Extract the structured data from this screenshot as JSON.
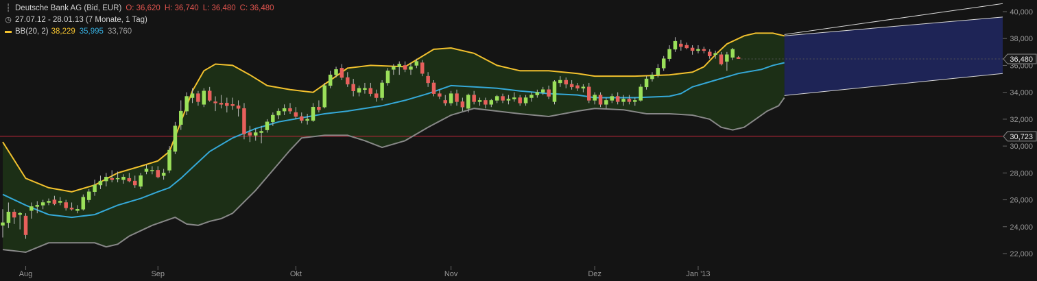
{
  "legend": {
    "instrument": "Deutsche Bank AG (Bid, EUR)",
    "open": "O: 36,620",
    "high": "H: 36,740",
    "low": "L: 36,480",
    "close": "C: 36,480",
    "period": "27.07.12 - 28.01.13 (7 Monate, 1 Tag)",
    "bb_label": "BB(20, 2)",
    "bb_upper": "38,229",
    "bb_middle": "35,995",
    "bb_lower": "33,760"
  },
  "colors": {
    "background": "#141414",
    "candle_up": "#9be05a",
    "candle_down": "#e8605c",
    "bb_upper": "#f2c12e",
    "bb_middle": "#35a9d8",
    "bb_lower": "#888888",
    "band_fill": "#1c2f16",
    "forecast_fill": "#1e2456",
    "reference_line": "#c0283a"
  },
  "chart_data": {
    "type": "candlestick",
    "title": "Deutsche Bank AG (Bid, EUR)",
    "ylim": [
      21.5,
      41.0
    ],
    "grid": false,
    "y_ticks": [
      22,
      24,
      26,
      28,
      30,
      32,
      34,
      36,
      38,
      40
    ],
    "y_tick_labels": [
      "22,000",
      "24,000",
      "26,000",
      "28,000",
      "30,000",
      "32,000",
      "34,000",
      "36,000",
      "38,000",
      "40,000"
    ],
    "x_ticks": [
      {
        "label": "Aug",
        "index": 4
      },
      {
        "label": "Sep",
        "index": 27
      },
      {
        "label": "Okt",
        "index": 51
      },
      {
        "label": "Nov",
        "index": 78
      },
      {
        "label": "Dez",
        "index": 103
      },
      {
        "label": "Jan '13",
        "index": 121
      }
    ],
    "last_price": {
      "label": "36,480",
      "value": 36.48
    },
    "reference_price": {
      "label": "30,723",
      "value": 30.723
    },
    "candles": [
      [
        24.1,
        25.3,
        23.2,
        24.3
      ],
      [
        24.3,
        25.8,
        23.9,
        25.1
      ],
      [
        25.1,
        25.3,
        24.2,
        24.7
      ],
      [
        24.9,
        25.1,
        23.8,
        25.0
      ],
      [
        24.8,
        25.0,
        23.1,
        23.4
      ],
      [
        25.2,
        25.8,
        24.6,
        25.5
      ],
      [
        25.5,
        25.9,
        25.0,
        25.6
      ],
      [
        25.6,
        26.0,
        25.3,
        25.8
      ],
      [
        25.8,
        26.1,
        25.6,
        25.9
      ],
      [
        26.0,
        26.3,
        25.6,
        25.7
      ],
      [
        25.8,
        26.2,
        25.6,
        25.9
      ],
      [
        25.8,
        26.0,
        25.2,
        25.4
      ],
      [
        25.4,
        25.8,
        25.2,
        25.3
      ],
      [
        25.2,
        25.6,
        25.0,
        25.3
      ],
      [
        25.3,
        26.4,
        25.2,
        26.2
      ],
      [
        26.0,
        26.8,
        25.8,
        26.6
      ],
      [
        26.6,
        27.5,
        26.3,
        27.1
      ],
      [
        27.1,
        27.8,
        26.8,
        27.4
      ],
      [
        27.4,
        28.0,
        27.0,
        27.7
      ],
      [
        27.6,
        28.2,
        27.3,
        27.5
      ],
      [
        27.6,
        28.1,
        27.3,
        27.6
      ],
      [
        27.5,
        27.9,
        27.2,
        27.7
      ],
      [
        27.6,
        28.0,
        27.3,
        27.4
      ],
      [
        27.4,
        27.8,
        26.9,
        27.1
      ],
      [
        27.0,
        28.0,
        26.8,
        27.8
      ],
      [
        28.1,
        28.6,
        27.9,
        28.3
      ],
      [
        28.2,
        28.5,
        27.9,
        28.2
      ],
      [
        28.2,
        28.5,
        27.6,
        27.7
      ],
      [
        27.8,
        28.3,
        27.5,
        28.0
      ],
      [
        28.2,
        30.0,
        28.0,
        29.7
      ],
      [
        29.6,
        31.8,
        29.4,
        31.5
      ],
      [
        31.6,
        33.4,
        31.2,
        32.6
      ],
      [
        32.6,
        34.0,
        32.3,
        33.7
      ],
      [
        33.6,
        34.3,
        33.2,
        33.9
      ],
      [
        33.9,
        34.1,
        33.0,
        33.3
      ],
      [
        33.1,
        34.3,
        32.9,
        34.1
      ],
      [
        34.1,
        34.4,
        33.3,
        33.4
      ],
      [
        33.3,
        33.7,
        32.6,
        33.2
      ],
      [
        33.2,
        33.8,
        32.8,
        33.1
      ],
      [
        33.2,
        33.6,
        32.5,
        33.0
      ],
      [
        33.1,
        33.6,
        32.7,
        33.0
      ],
      [
        33.0,
        33.4,
        32.2,
        32.8
      ],
      [
        32.8,
        33.2,
        30.5,
        30.9
      ],
      [
        31.0,
        31.5,
        30.3,
        30.8
      ],
      [
        30.8,
        31.3,
        30.4,
        31.0
      ],
      [
        31.0,
        31.5,
        30.2,
        31.1
      ],
      [
        31.2,
        32.0,
        31.0,
        31.8
      ],
      [
        31.8,
        32.5,
        31.5,
        32.3
      ],
      [
        32.3,
        32.8,
        32.0,
        32.6
      ],
      [
        32.6,
        33.1,
        32.3,
        32.8
      ],
      [
        32.8,
        33.2,
        32.4,
        32.6
      ],
      [
        32.5,
        32.9,
        32.0,
        32.2
      ],
      [
        32.2,
        32.5,
        31.7,
        31.9
      ],
      [
        31.9,
        32.4,
        31.6,
        32.0
      ],
      [
        31.9,
        33.2,
        31.8,
        32.9
      ],
      [
        32.9,
        33.4,
        32.5,
        32.7
      ],
      [
        32.9,
        34.7,
        32.8,
        34.5
      ],
      [
        34.5,
        35.6,
        34.3,
        35.3
      ],
      [
        35.3,
        35.9,
        35.1,
        35.7
      ],
      [
        35.8,
        36.1,
        34.9,
        35.1
      ],
      [
        35.1,
        35.5,
        34.4,
        34.6
      ],
      [
        34.6,
        35.0,
        33.7,
        34.1
      ],
      [
        34.0,
        34.5,
        33.7,
        34.3
      ],
      [
        34.2,
        34.7,
        33.9,
        34.3
      ],
      [
        34.3,
        34.7,
        33.7,
        33.9
      ],
      [
        33.9,
        34.2,
        33.3,
        33.6
      ],
      [
        33.6,
        34.9,
        33.4,
        34.7
      ],
      [
        34.7,
        35.8,
        34.5,
        35.6
      ],
      [
        35.7,
        36.1,
        35.3,
        35.9
      ],
      [
        35.9,
        36.3,
        35.3,
        36.1
      ],
      [
        36.0,
        36.3,
        35.5,
        35.7
      ],
      [
        35.7,
        36.2,
        35.3,
        35.9
      ],
      [
        36.0,
        36.5,
        35.8,
        36.3
      ],
      [
        36.2,
        36.4,
        35.2,
        35.4
      ],
      [
        35.2,
        35.5,
        34.4,
        34.7
      ],
      [
        34.7,
        34.9,
        33.7,
        33.9
      ],
      [
        33.9,
        34.2,
        33.5,
        33.7
      ],
      [
        33.4,
        33.8,
        33.0,
        33.2
      ],
      [
        33.2,
        34.1,
        33.0,
        33.9
      ],
      [
        33.9,
        34.2,
        33.0,
        33.3
      ],
      [
        33.3,
        33.6,
        32.6,
        32.9
      ],
      [
        32.8,
        33.9,
        32.5,
        33.8
      ],
      [
        33.8,
        34.1,
        33.1,
        33.3
      ],
      [
        33.3,
        33.6,
        33.0,
        33.4
      ],
      [
        33.4,
        33.6,
        32.8,
        33.1
      ],
      [
        33.1,
        33.5,
        32.9,
        33.4
      ],
      [
        33.4,
        33.8,
        33.2,
        33.7
      ],
      [
        33.7,
        33.9,
        33.2,
        33.4
      ],
      [
        33.4,
        33.8,
        33.1,
        33.5
      ],
      [
        33.5,
        34.0,
        33.3,
        33.6
      ],
      [
        33.6,
        33.8,
        33.0,
        33.2
      ],
      [
        33.2,
        33.8,
        33.0,
        33.6
      ],
      [
        33.6,
        34.0,
        33.3,
        33.8
      ],
      [
        33.8,
        34.2,
        33.6,
        34.0
      ],
      [
        34.0,
        34.4,
        33.8,
        34.2
      ],
      [
        34.2,
        34.5,
        33.5,
        33.7
      ],
      [
        33.3,
        34.9,
        33.1,
        34.8
      ],
      [
        34.7,
        35.2,
        34.4,
        34.9
      ],
      [
        34.9,
        35.1,
        34.3,
        34.6
      ],
      [
        34.6,
        34.9,
        34.2,
        34.4
      ],
      [
        34.5,
        34.7,
        34.1,
        34.3
      ],
      [
        34.3,
        34.6,
        34.0,
        34.4
      ],
      [
        34.4,
        34.7,
        33.2,
        33.4
      ],
      [
        33.4,
        34.0,
        33.1,
        33.8
      ],
      [
        33.8,
        34.0,
        32.9,
        33.1
      ],
      [
        33.1,
        33.6,
        32.8,
        33.4
      ],
      [
        33.4,
        33.9,
        33.2,
        33.7
      ],
      [
        33.7,
        34.0,
        33.1,
        33.3
      ],
      [
        33.3,
        33.8,
        33.0,
        33.5
      ],
      [
        33.5,
        33.8,
        33.1,
        33.3
      ],
      [
        33.3,
        33.6,
        33.0,
        33.4
      ],
      [
        33.4,
        34.6,
        33.3,
        34.4
      ],
      [
        34.4,
        35.2,
        34.2,
        35.0
      ],
      [
        35.0,
        35.5,
        34.8,
        35.3
      ],
      [
        35.3,
        36.1,
        35.1,
        35.8
      ],
      [
        35.8,
        36.7,
        35.6,
        36.5
      ],
      [
        36.5,
        37.5,
        36.3,
        37.2
      ],
      [
        37.2,
        38.1,
        37.0,
        37.8
      ],
      [
        37.6,
        37.9,
        37.1,
        37.4
      ],
      [
        37.5,
        37.7,
        37.2,
        37.3
      ],
      [
        37.3,
        37.5,
        36.8,
        37.1
      ],
      [
        37.1,
        37.5,
        36.9,
        37.2
      ],
      [
        37.2,
        37.4,
        36.9,
        37.1
      ],
      [
        37.0,
        37.2,
        36.5,
        36.7
      ],
      [
        36.8,
        37.1,
        36.5,
        36.9
      ],
      [
        36.8,
        37.0,
        36.0,
        36.1
      ],
      [
        36.3,
        37.0,
        35.6,
        36.8
      ],
      [
        36.6,
        37.3,
        36.4,
        37.2
      ],
      [
        36.6,
        36.7,
        36.5,
        36.5
      ]
    ],
    "bb_upper": [
      [
        0,
        30.3
      ],
      [
        4,
        27.6
      ],
      [
        8,
        26.9
      ],
      [
        12,
        26.6
      ],
      [
        16,
        27.1
      ],
      [
        20,
        28.0
      ],
      [
        24,
        28.5
      ],
      [
        27,
        28.9
      ],
      [
        29,
        29.6
      ],
      [
        31,
        31.8
      ],
      [
        33,
        34.1
      ],
      [
        35,
        35.6
      ],
      [
        37,
        36.1
      ],
      [
        40,
        36.0
      ],
      [
        43,
        35.3
      ],
      [
        46,
        34.5
      ],
      [
        50,
        34.2
      ],
      [
        54,
        34.0
      ],
      [
        57,
        34.9
      ],
      [
        60,
        35.8
      ],
      [
        64,
        36.0
      ],
      [
        70,
        35.9
      ],
      [
        75,
        37.2
      ],
      [
        78,
        37.3
      ],
      [
        82,
        36.9
      ],
      [
        86,
        36.0
      ],
      [
        90,
        35.6
      ],
      [
        95,
        35.6
      ],
      [
        100,
        35.4
      ],
      [
        103,
        35.2
      ],
      [
        106,
        35.2
      ],
      [
        110,
        35.2
      ],
      [
        116,
        35.3
      ],
      [
        120,
        35.5
      ],
      [
        122,
        35.9
      ],
      [
        124,
        36.8
      ],
      [
        126,
        37.6
      ],
      [
        129,
        38.2
      ],
      [
        131,
        38.4
      ],
      [
        134,
        38.4
      ],
      [
        136,
        38.2
      ]
    ],
    "bb_middle": [
      [
        0,
        26.4
      ],
      [
        4,
        25.6
      ],
      [
        8,
        24.9
      ],
      [
        12,
        24.7
      ],
      [
        16,
        24.9
      ],
      [
        20,
        25.6
      ],
      [
        24,
        26.1
      ],
      [
        27,
        26.6
      ],
      [
        29,
        26.9
      ],
      [
        31,
        27.6
      ],
      [
        33,
        28.4
      ],
      [
        36,
        29.6
      ],
      [
        40,
        30.6
      ],
      [
        44,
        31.3
      ],
      [
        48,
        31.8
      ],
      [
        52,
        32.1
      ],
      [
        56,
        32.4
      ],
      [
        60,
        32.6
      ],
      [
        66,
        33.0
      ],
      [
        70,
        33.4
      ],
      [
        74,
        33.9
      ],
      [
        78,
        34.5
      ],
      [
        82,
        34.4
      ],
      [
        86,
        34.3
      ],
      [
        90,
        34.1
      ],
      [
        95,
        33.9
      ],
      [
        100,
        33.8
      ],
      [
        103,
        33.6
      ],
      [
        110,
        33.6
      ],
      [
        116,
        33.7
      ],
      [
        118,
        33.9
      ],
      [
        120,
        34.4
      ],
      [
        124,
        34.9
      ],
      [
        128,
        35.4
      ],
      [
        132,
        35.7
      ],
      [
        134,
        36.0
      ],
      [
        136,
        36.2
      ]
    ],
    "bb_lower": [
      [
        0,
        22.3
      ],
      [
        4,
        22.1
      ],
      [
        8,
        22.8
      ],
      [
        12,
        22.8
      ],
      [
        16,
        22.8
      ],
      [
        18,
        22.5
      ],
      [
        20,
        22.7
      ],
      [
        22,
        23.3
      ],
      [
        24,
        23.7
      ],
      [
        26,
        24.1
      ],
      [
        28,
        24.4
      ],
      [
        30,
        24.7
      ],
      [
        32,
        24.2
      ],
      [
        34,
        24.1
      ],
      [
        36,
        24.4
      ],
      [
        38,
        24.6
      ],
      [
        40,
        25.0
      ],
      [
        44,
        26.7
      ],
      [
        48,
        28.7
      ],
      [
        50,
        29.7
      ],
      [
        52,
        30.6
      ],
      [
        56,
        30.8
      ],
      [
        60,
        30.8
      ],
      [
        63,
        30.4
      ],
      [
        66,
        29.9
      ],
      [
        70,
        30.4
      ],
      [
        74,
        31.4
      ],
      [
        78,
        32.3
      ],
      [
        82,
        32.8
      ],
      [
        86,
        32.6
      ],
      [
        90,
        32.4
      ],
      [
        95,
        32.2
      ],
      [
        100,
        32.6
      ],
      [
        103,
        32.8
      ],
      [
        108,
        32.7
      ],
      [
        112,
        32.4
      ],
      [
        116,
        32.4
      ],
      [
        120,
        32.3
      ],
      [
        123,
        32.0
      ],
      [
        125,
        31.4
      ],
      [
        127,
        31.2
      ],
      [
        129,
        31.4
      ],
      [
        131,
        32.0
      ],
      [
        133,
        32.6
      ],
      [
        135,
        33.0
      ],
      [
        136,
        33.6
      ]
    ],
    "forecast": {
      "from_index": 136,
      "upper_start": 38.2,
      "upper_end": 39.6,
      "lower_start": 33.76,
      "lower_end": 35.4,
      "outer_start": 38.3,
      "outer_end": 40.6
    }
  }
}
